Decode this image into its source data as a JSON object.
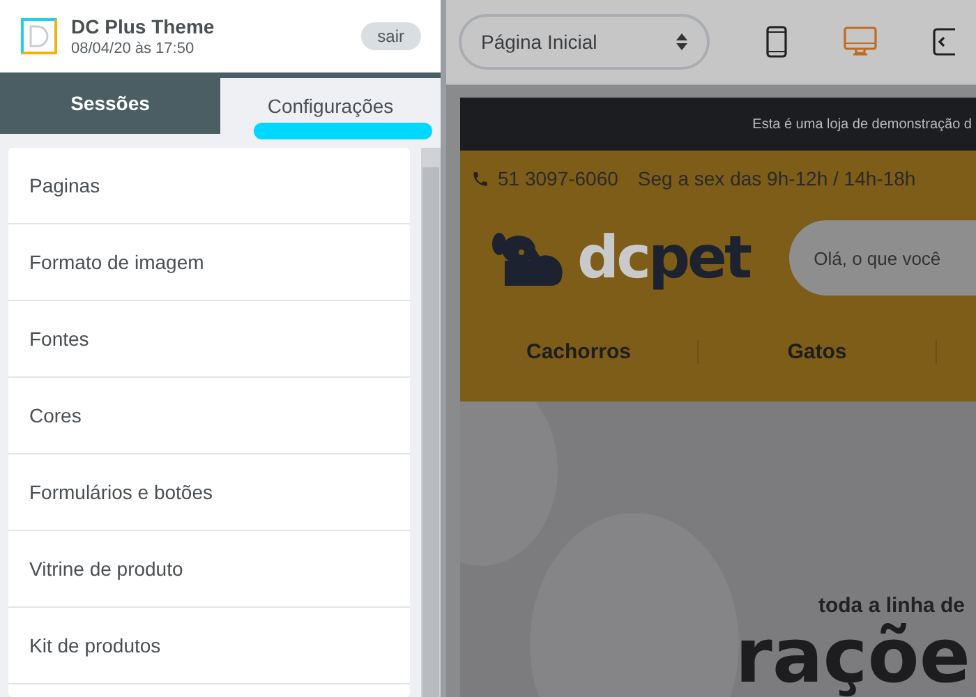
{
  "header": {
    "title": "DC Plus Theme",
    "subtitle": "08/04/20 às 17:50",
    "logout": "sair"
  },
  "tabs": [
    {
      "label": "Sessões",
      "selected": false
    },
    {
      "label": "Configurações",
      "selected": true
    }
  ],
  "menu": [
    "Paginas",
    "Formato de imagem",
    "Fontes",
    "Cores",
    "Formulários e botões",
    "Vitrine de produto",
    "Kit de produtos"
  ],
  "toolbar": {
    "page_select": "Página Inicial",
    "devices": [
      {
        "kind": "mobile",
        "selected": false
      },
      {
        "kind": "desktop",
        "selected": true
      },
      {
        "kind": "code",
        "selected": false
      }
    ]
  },
  "preview": {
    "notice": "Esta é uma loja de demonstração d",
    "phone": "51 3097-6060",
    "hours": "Seg a sex das 9h-12h / 14h-18h",
    "logo": {
      "light": "dc",
      "dark": "pet"
    },
    "search_placeholder": "Olá, o que você",
    "nav": [
      "Cachorros",
      "Gatos"
    ],
    "banner_small": "toda a linha de",
    "banner_big": "raçõe"
  }
}
